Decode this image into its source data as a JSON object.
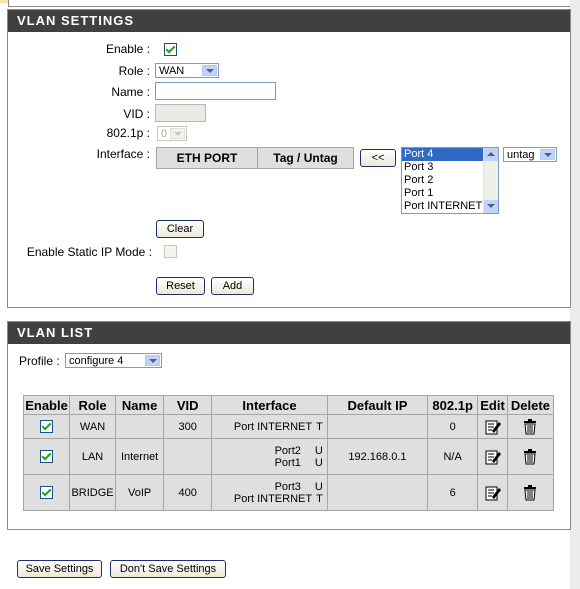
{
  "vlan_settings": {
    "title": "VLAN SETTINGS",
    "enable_label": "Enable :",
    "role_label": "Role :",
    "role_value": "WAN",
    "name_label": "Name :",
    "name_value": "",
    "vid_label": "VID :",
    "vid_value": "",
    "p8021_label": "802.1p :",
    "p8021_value": "0",
    "interface_label": "Interface :",
    "iface_col_eth": "ETH PORT",
    "iface_col_tag": "Tag / Untag",
    "move_button": "<<",
    "ports": [
      "Port 4",
      "Port 3",
      "Port 2",
      "Port 1",
      "Port INTERNET"
    ],
    "tag_value": "untag",
    "clear_button": "Clear",
    "static_ip_label": "Enable Static IP Mode :",
    "reset_button": "Reset",
    "add_button": "Add"
  },
  "vlan_list": {
    "title": "VLAN LIST",
    "profile_label": "Profile :",
    "profile_value": "configure 4",
    "headers": [
      "Enable",
      "Role",
      "Name",
      "VID",
      "Interface",
      "Default IP",
      "802.1p",
      "Edit",
      "Delete"
    ],
    "rows": [
      {
        "role": "WAN",
        "name": "",
        "vid": "300",
        "iface": [
          [
            "Port INTERNET",
            "T"
          ]
        ],
        "ip": "",
        "p": "0"
      },
      {
        "role": "LAN",
        "name": "Internet",
        "vid": "",
        "iface": [
          [
            "Port2",
            "U"
          ],
          [
            "Port1",
            "U"
          ]
        ],
        "ip": "192.168.0.1",
        "p": "N/A"
      },
      {
        "role": "BRIDGE",
        "name": "VoIP",
        "vid": "400",
        "iface": [
          [
            "Port3",
            "U"
          ],
          [
            "Port INTERNET",
            "T"
          ]
        ],
        "ip": "",
        "p": "6"
      }
    ]
  },
  "footer": {
    "save_button": "Save Settings",
    "dont_save_button": "Don't Save Settings"
  }
}
